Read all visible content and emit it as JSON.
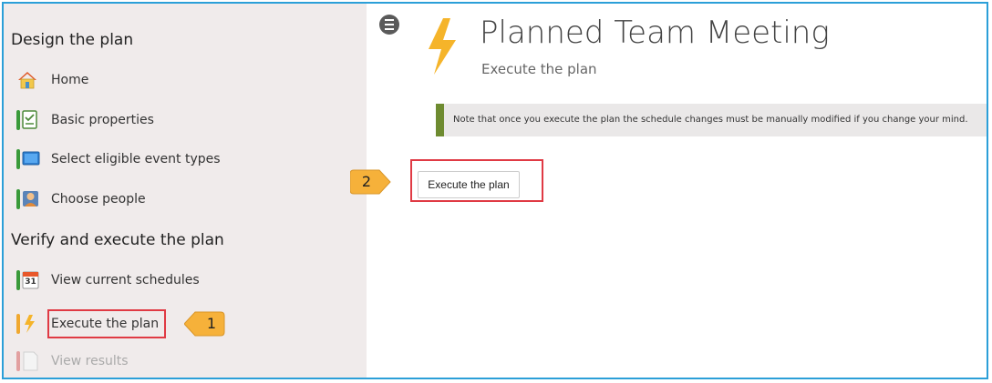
{
  "sidebar": {
    "section1_title": "Design the plan",
    "section2_title": "Verify and execute the plan",
    "items": [
      {
        "label": "Home",
        "icon": "home-icon"
      },
      {
        "label": "Basic properties",
        "icon": "checklist-icon"
      },
      {
        "label": "Select eligible event types",
        "icon": "monitor-icon"
      },
      {
        "label": "Choose people",
        "icon": "person-icon"
      },
      {
        "label": "View current schedules",
        "icon": "calendar-icon",
        "calendar_day": "31"
      },
      {
        "label": "Execute the plan",
        "icon": "lightning-icon",
        "highlighted": true
      },
      {
        "label": "View results",
        "icon": "document-icon",
        "disabled": true
      }
    ]
  },
  "main": {
    "title": "Planned Team Meeting",
    "subtitle": "Execute the plan",
    "note": "Note that once you execute the plan the schedule changes must be manually modified if you change your mind.",
    "execute_button": "Execute the plan"
  },
  "callouts": [
    "1",
    "2"
  ],
  "colors": {
    "frame": "#2b9fd8",
    "sidebar_bg": "#f0ebeb",
    "highlight": "#e03a44",
    "callout": "#f6b13a",
    "note_bar": "#6e8b30",
    "bolt": "#f5b42a"
  }
}
